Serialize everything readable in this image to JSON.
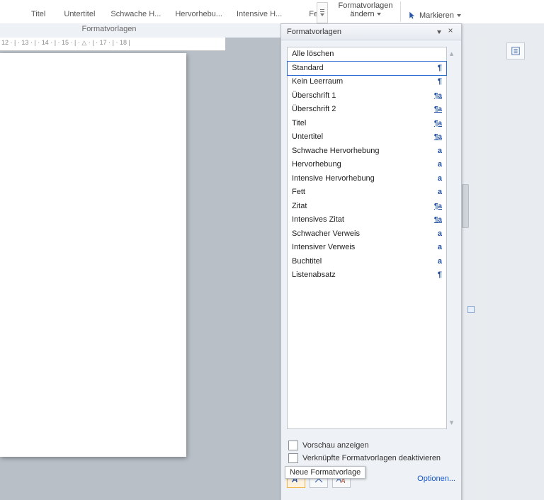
{
  "ribbon": {
    "styles": [
      "Titel",
      "Untertitel",
      "Schwache H...",
      "Hervorhebu...",
      "Intensive H...",
      "Fett"
    ],
    "change_styles_l1": "Formatvorlagen",
    "change_styles_l2": "ändern",
    "markieren": "Markieren"
  },
  "group_label": "Formatvorlagen",
  "ruler_text": "12 · | · 13 · | · 14 · | · 15 · | · △ · | · 17 · | · 18 |",
  "pane": {
    "title": "Formatvorlagen",
    "items": [
      {
        "label": "Alle löschen",
        "sym": ""
      },
      {
        "label": "Standard",
        "sym": "para",
        "selected": true
      },
      {
        "label": "Kein Leerraum",
        "sym": "para"
      },
      {
        "label": "Überschrift 1",
        "sym": "linked"
      },
      {
        "label": "Überschrift 2",
        "sym": "linked"
      },
      {
        "label": "Titel",
        "sym": "linked"
      },
      {
        "label": "Untertitel",
        "sym": "linked"
      },
      {
        "label": "Schwache Hervorhebung",
        "sym": "char"
      },
      {
        "label": "Hervorhebung",
        "sym": "char"
      },
      {
        "label": "Intensive Hervorhebung",
        "sym": "char"
      },
      {
        "label": "Fett",
        "sym": "char"
      },
      {
        "label": "Zitat",
        "sym": "linked"
      },
      {
        "label": "Intensives Zitat",
        "sym": "linked"
      },
      {
        "label": "Schwacher Verweis",
        "sym": "char"
      },
      {
        "label": "Intensiver Verweis",
        "sym": "char"
      },
      {
        "label": "Buchtitel",
        "sym": "char"
      },
      {
        "label": "Listenabsatz",
        "sym": "para"
      }
    ],
    "chk_preview": "Vorschau anzeigen",
    "chk_linked": "Verknüpfte Formatvorlagen deaktivieren",
    "options": "Optionen...",
    "tooltip": "Neue Formatvorlage"
  }
}
